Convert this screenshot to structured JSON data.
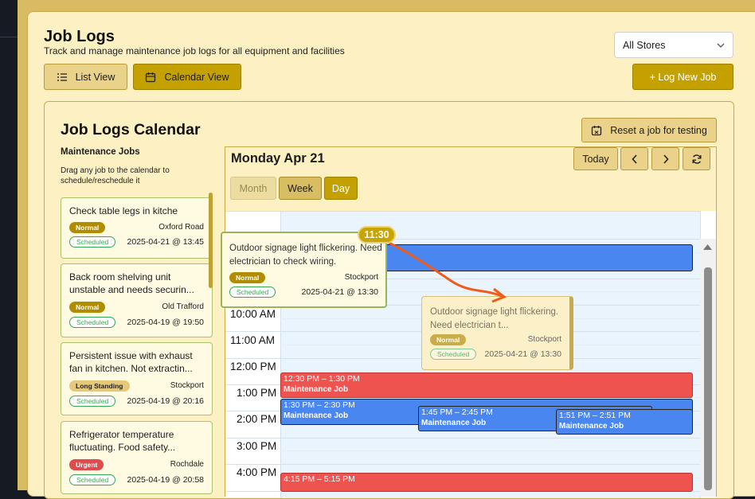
{
  "header": {
    "title": "Job Logs",
    "subtitle": "Track and manage maintenance job logs for all equipment and facilities",
    "list_view_label": "List View",
    "calendar_view_label": "Calendar View",
    "store_select_value": "All Stores",
    "log_new_job_label": "+ Log New Job"
  },
  "calendar_panel": {
    "title": "Job Logs Calendar",
    "reset_label": "Reset a job for testing",
    "maintenance_jobs_heading": "Maintenance Jobs",
    "maintenance_jobs_help": "Drag any job to the calendar to schedule/reschedule it"
  },
  "jobs": [
    {
      "title": "Check table legs in kitche",
      "priority": "Normal",
      "location": "Oxford Road",
      "status": "Scheduled",
      "datetime": "2025-04-21 @ 13:45"
    },
    {
      "title": "Back room shelving unit unstable and needs securin...",
      "priority": "Normal",
      "location": "Old Trafford",
      "status": "Scheduled",
      "datetime": "2025-04-19 @ 19:50"
    },
    {
      "title": "Persistent issue with exhaust fan in kitchen. Not extractin...",
      "priority": "Long Standing",
      "location": "Stockport",
      "status": "Scheduled",
      "datetime": "2025-04-19 @ 20:16"
    },
    {
      "title": "Refrigerator temperature fluctuating. Food safety...",
      "priority": "Urgent",
      "location": "Rochdale",
      "status": "Scheduled",
      "datetime": "2025-04-19 @ 20:58"
    }
  ],
  "calendar": {
    "date_title": "Monday Apr 21",
    "today_label": "Today",
    "prev_icon": "chevron-left-icon",
    "next_icon": "chevron-right-icon",
    "refresh_icon": "refresh-icon",
    "views": {
      "month": "Month",
      "week": "Week",
      "day": "Day"
    },
    "time_labels": [
      "10:00 AM",
      "11:00 AM",
      "12:00 PM",
      "1:00 PM",
      "2:00 PM",
      "3:00 PM",
      "4:00 PM"
    ],
    "events": [
      {
        "time": "12:30 PM – 1:30 PM",
        "name": "Maintenance Job",
        "color": "#ef5350"
      },
      {
        "time": "1:30 PM – 2:30 PM",
        "name": "Maintenance Job",
        "color": "#4a86f0"
      },
      {
        "time": "1:45 PM – 2:45 PM",
        "name": "Maintenance Job",
        "color": "#4a86f0"
      },
      {
        "time": "1:51 PM – 2:51 PM",
        "name": "Maintenance Job",
        "color": "#4a86f0"
      },
      {
        "time": "4:15 PM – 5:15 PM",
        "name": "",
        "color": "#ef5350"
      }
    ]
  },
  "drag": {
    "time_bubble": "11:30",
    "title": "Outdoor signage light flickering. Need electrician to check wiring.",
    "ghost_title": "Outdoor signage light flickering. Need electrician t...",
    "priority": "Normal",
    "location": "Stockport",
    "status": "Scheduled",
    "datetime": "2025-04-21 @ 13:30"
  },
  "colors": {
    "accent": "#c5a100",
    "panel_bg": "#fdf0c2",
    "event_blue": "#4a86f0",
    "event_red": "#ef5350",
    "drag_arrow": "#f05a1a"
  }
}
